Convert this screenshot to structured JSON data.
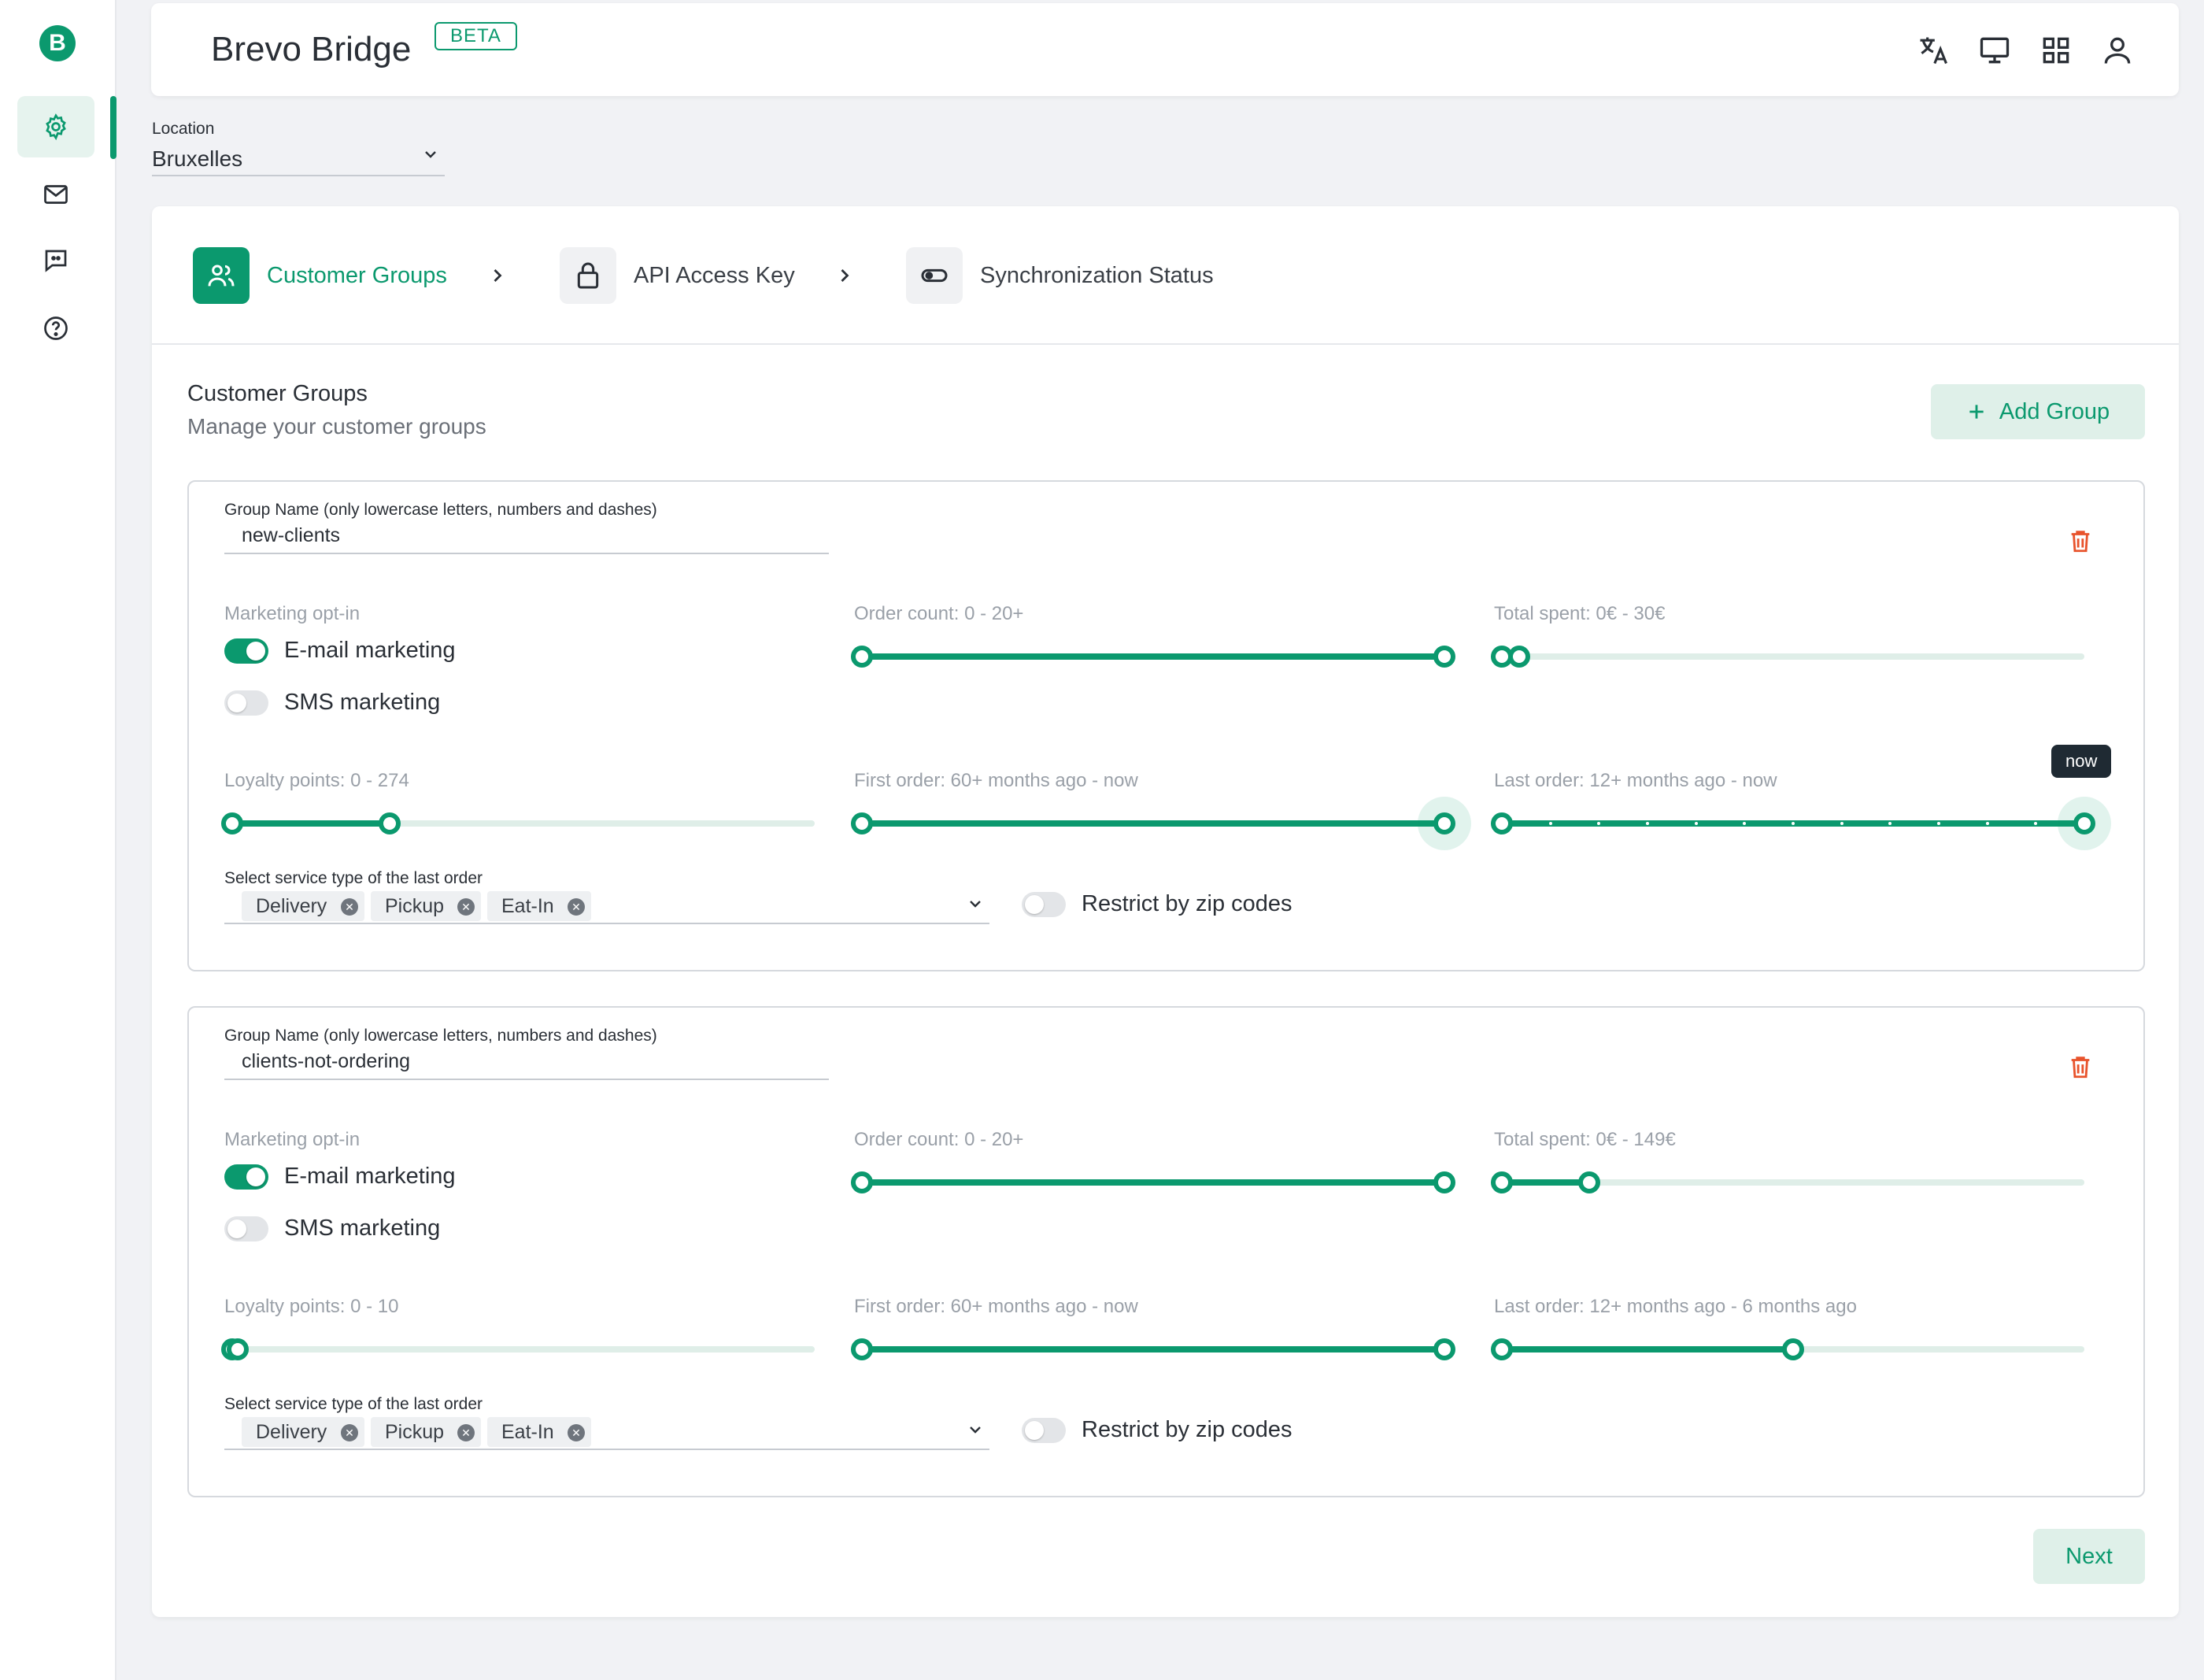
{
  "app": {
    "title": "Brevo Bridge",
    "badge": "BETA",
    "logo_letter": "B"
  },
  "sidebar": {
    "items": [
      {
        "name": "settings",
        "active": true
      },
      {
        "name": "mail"
      },
      {
        "name": "feedback"
      },
      {
        "name": "help"
      }
    ]
  },
  "header_icons": [
    "translate-icon",
    "monitor-icon",
    "apps-grid-icon",
    "account-icon"
  ],
  "location": {
    "label": "Location",
    "value": "Bruxelles"
  },
  "steps": [
    {
      "label": "Customer Groups",
      "active": true,
      "icon": "users-icon"
    },
    {
      "label": "API Access Key",
      "active": false,
      "icon": "lock-icon"
    },
    {
      "label": "Synchronization Status",
      "active": false,
      "icon": "toggle-icon"
    }
  ],
  "section": {
    "title": "Customer Groups",
    "subtitle": "Manage your customer groups",
    "add_label": "Add Group"
  },
  "groups": [
    {
      "name_label": "Group Name (only lowercase letters, numbers and dashes)",
      "name": "new-clients",
      "optin_label": "Marketing opt-in",
      "email_label": "E-mail marketing",
      "email_on": true,
      "sms_label": "SMS marketing",
      "sms_on": false,
      "order_count_label": "Order count: 0 - 20+",
      "total_spent_label": "Total spent: 0€ - 30€",
      "loyalty_label": "Loyalty points: 0 - 274",
      "first_order_label": "First order: 60+ months ago - now",
      "last_order_label": "Last order: 12+ months ago - now",
      "last_order_tooltip": "now",
      "service_label": "Select service type of the last order",
      "services": [
        "Delivery",
        "Pickup",
        "Eat-In"
      ],
      "zip_label": "Restrict by zip codes",
      "zip_on": false,
      "sliders": {
        "order_count": [
          0.0,
          1.0
        ],
        "total_spent": [
          0.0,
          0.03
        ],
        "loyalty": [
          0.0,
          0.27
        ],
        "first_order": [
          0.0,
          1.0
        ],
        "last_order": [
          0.0,
          1.0
        ]
      }
    },
    {
      "name_label": "Group Name (only lowercase letters, numbers and dashes)",
      "name": "clients-not-ordering",
      "optin_label": "Marketing opt-in",
      "email_label": "E-mail marketing",
      "email_on": true,
      "sms_label": "SMS marketing",
      "sms_on": false,
      "order_count_label": "Order count: 0 - 20+",
      "total_spent_label": "Total spent: 0€ - 149€",
      "loyalty_label": "Loyalty points: 0 - 10",
      "first_order_label": "First order: 60+ months ago - now",
      "last_order_label": "Last order: 12+ months ago - 6 months ago",
      "service_label": "Select service type of the last order",
      "services": [
        "Delivery",
        "Pickup",
        "Eat-In"
      ],
      "zip_label": "Restrict by zip codes",
      "zip_on": false,
      "sliders": {
        "order_count": [
          0.0,
          1.0
        ],
        "total_spent": [
          0.0,
          0.15
        ],
        "loyalty": [
          0.0,
          0.01
        ],
        "first_order": [
          0.0,
          1.0
        ],
        "last_order": [
          0.0,
          0.5
        ]
      }
    }
  ],
  "footer": {
    "next_label": "Next"
  },
  "colors": {
    "accent": "#0b996e",
    "accent_light": "#dff0e9",
    "danger": "#e8532c"
  }
}
